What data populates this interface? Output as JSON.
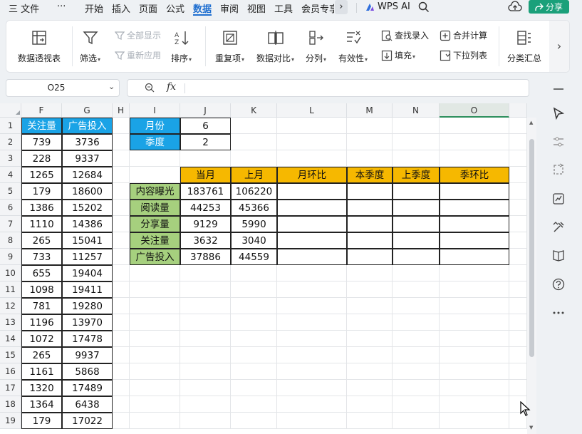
{
  "menu": {
    "file": "三 文件",
    "more": "···",
    "tabs": [
      "开始",
      "插入",
      "页面",
      "公式",
      "数据",
      "审阅",
      "视图",
      "工具",
      "会员专享"
    ],
    "active_tab": "数据",
    "wps_ai": "WPS AI",
    "share": "分享"
  },
  "ribbon": {
    "pivot": "数据透视表",
    "filter": "筛选",
    "show_all": "全部显示",
    "reapply": "重新应用",
    "sort": "排序",
    "duplicates": "重复项",
    "compare": "数据对比",
    "split": "分列",
    "validity": "有效性",
    "find_entry": "查找录入",
    "fill": "填充",
    "merge_calc": "合并计算",
    "dropdown_list": "下拉列表",
    "subtotal": "分类汇总"
  },
  "formula_bar": {
    "cell_ref": "O25",
    "fx": "fx",
    "value": ""
  },
  "columns": [
    "F",
    "G",
    "H",
    "I",
    "J",
    "K",
    "L",
    "M",
    "N",
    "O"
  ],
  "selected_column": "O",
  "rows": [
    "1",
    "2",
    "3",
    "4",
    "5",
    "6",
    "7",
    "8",
    "9",
    "10",
    "11",
    "12",
    "13",
    "14",
    "15",
    "16",
    "17",
    "18",
    "19"
  ],
  "left_table": {
    "headers": [
      "关注量",
      "广告投入"
    ],
    "rows": [
      [
        "739",
        "3736"
      ],
      [
        "228",
        "9337"
      ],
      [
        "1265",
        "12684"
      ],
      [
        "179",
        "18600"
      ],
      [
        "1386",
        "15202"
      ],
      [
        "1110",
        "14386"
      ],
      [
        "265",
        "15041"
      ],
      [
        "733",
        "11257"
      ],
      [
        "655",
        "19404"
      ],
      [
        "1098",
        "19411"
      ],
      [
        "781",
        "19280"
      ],
      [
        "1196",
        "13970"
      ],
      [
        "1072",
        "17478"
      ],
      [
        "265",
        "9937"
      ],
      [
        "1161",
        "5868"
      ],
      [
        "1320",
        "17489"
      ],
      [
        "1364",
        "6438"
      ],
      [
        "179",
        "17022"
      ]
    ]
  },
  "params": {
    "month_label": "月份",
    "month_value": "6",
    "quarter_label": "季度",
    "quarter_value": "2"
  },
  "summary": {
    "headers": [
      "当月",
      "上月",
      "月环比",
      "本季度",
      "上季度",
      "季环比"
    ],
    "rows": [
      {
        "label": "内容曝光",
        "cur": "183761",
        "prev": "106220"
      },
      {
        "label": "阅读量",
        "cur": "44253",
        "prev": "45366"
      },
      {
        "label": "分享量",
        "cur": "9129",
        "prev": "5990"
      },
      {
        "label": "关注量",
        "cur": "3632",
        "prev": "3040"
      },
      {
        "label": "广告投入",
        "cur": "37886",
        "prev": "44559"
      }
    ]
  },
  "colors": {
    "blue_header": "#1aa3e6",
    "gold_header": "#f6b800",
    "green_label": "#a6d07e",
    "accent": "#1f6fd0",
    "share_green": "#1aa07a"
  }
}
